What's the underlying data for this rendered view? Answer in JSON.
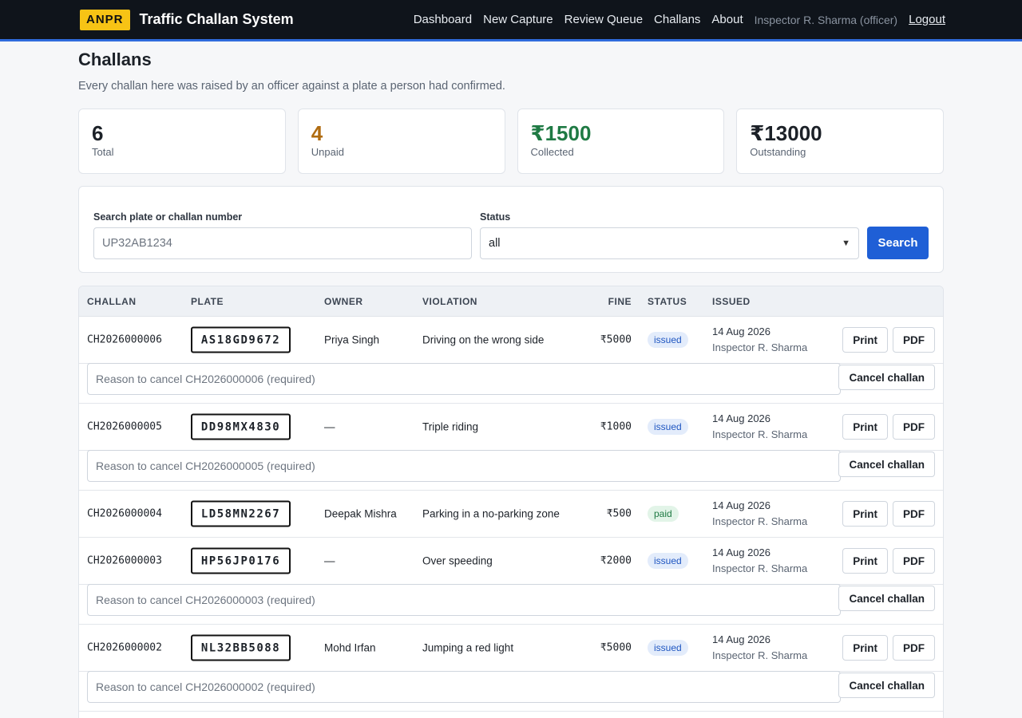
{
  "header": {
    "logo": "ANPR",
    "title": "Traffic Challan System",
    "nav": [
      "Dashboard",
      "New Capture",
      "Review Queue",
      "Challans",
      "About"
    ],
    "user": "Inspector R. Sharma (officer)",
    "logout": "Logout"
  },
  "page": {
    "title": "Challans",
    "subtitle": "Every challan here was raised by an officer against a plate a person had confirmed."
  },
  "stats": [
    {
      "value": "6",
      "label": "Total"
    },
    {
      "value": "4",
      "label": "Unpaid"
    },
    {
      "value": "₹1500",
      "label": "Collected"
    },
    {
      "value": "₹13000",
      "label": "Outstanding"
    }
  ],
  "search": {
    "label": "Search plate or challan number",
    "placeholder": "UP32AB1234",
    "status_label": "Status",
    "status_value": "all",
    "button": "Search"
  },
  "table": {
    "headers": [
      "Challan",
      "Plate",
      "Owner",
      "Violation",
      "Fine",
      "Status",
      "Issued"
    ],
    "print_label": "Print",
    "pdf_label": "PDF",
    "cancel_label": "Cancel challan",
    "rows": [
      {
        "challan": "CH2026000006",
        "plate": "AS18GD9672",
        "owner": "Priya Singh",
        "violation": "Driving on the wrong side",
        "fine": "₹5000",
        "status": "issued",
        "date": "14 Aug 2026",
        "by": "Inspector R. Sharma",
        "cancel_placeholder": "Reason to cancel CH2026000006 (required)"
      },
      {
        "challan": "CH2026000005",
        "plate": "DD98MX4830",
        "owner": "—",
        "violation": "Triple riding",
        "fine": "₹1000",
        "status": "issued",
        "date": "14 Aug 2026",
        "by": "Inspector R. Sharma",
        "cancel_placeholder": "Reason to cancel CH2026000005 (required)"
      },
      {
        "challan": "CH2026000004",
        "plate": "LD58MN2267",
        "owner": "Deepak Mishra",
        "violation": "Parking in a no-parking zone",
        "fine": "₹500",
        "status": "paid",
        "date": "14 Aug 2026",
        "by": "Inspector R. Sharma",
        "cancel_placeholder": ""
      },
      {
        "challan": "CH2026000003",
        "plate": "HP56JP0176",
        "owner": "—",
        "violation": "Over speeding",
        "fine": "₹2000",
        "status": "issued",
        "date": "14 Aug 2026",
        "by": "Inspector R. Sharma",
        "cancel_placeholder": "Reason to cancel CH2026000003 (required)"
      },
      {
        "challan": "CH2026000002",
        "plate": "NL32BB5088",
        "owner": "Mohd Irfan",
        "violation": "Jumping a red light",
        "fine": "₹5000",
        "status": "issued",
        "date": "14 Aug 2026",
        "by": "Inspector R. Sharma",
        "cancel_placeholder": "Reason to cancel CH2026000002 (required)"
      }
    ]
  }
}
